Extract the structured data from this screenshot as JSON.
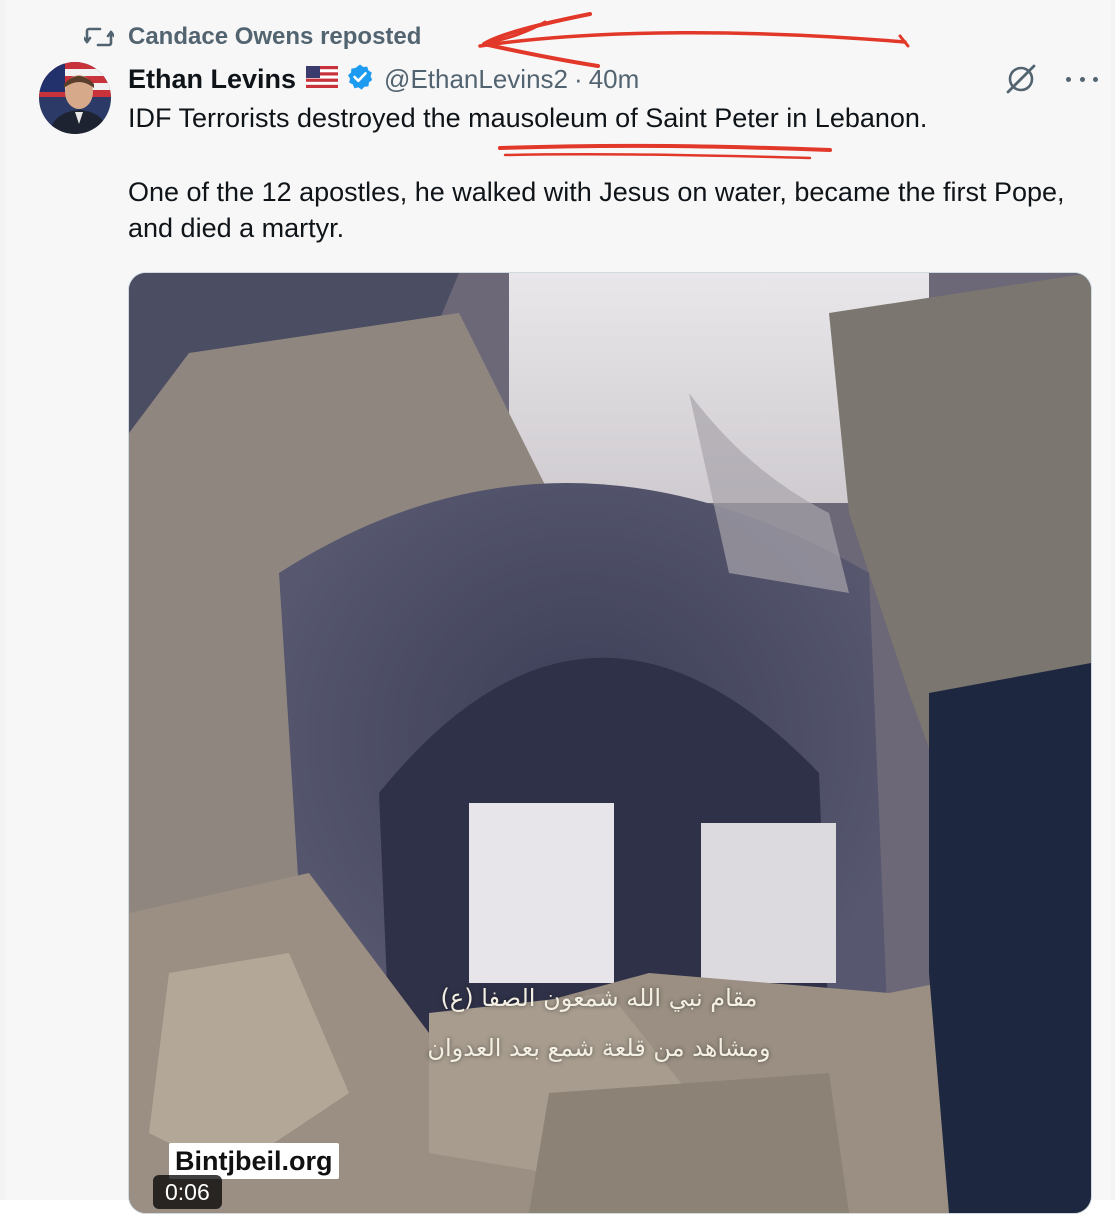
{
  "repost": {
    "icon": "repost-icon",
    "text": "Candace Owens reposted"
  },
  "author": {
    "name": "Ethan Levins",
    "flag": "us-flag",
    "verified_icon": "verified-badge-icon",
    "handle": "@EthanLevins2",
    "separator": "·",
    "time": "40m"
  },
  "tweet": {
    "line1": "IDF Terrorists destroyed the mausoleum of Saint Peter in Lebanon.",
    "line2": "One of the 12 apostles, he walked with Jesus on water, became the first Pope, and died a martyr."
  },
  "media": {
    "caption_ar_1": "مقام نبي الله شمعون الصفا (ع)",
    "caption_ar_2": "ومشاهد من قلعة شمع بعد العدوان",
    "watermark": "Bintjbeil.org",
    "duration": "0:06"
  },
  "icons": {
    "grok": "grok-icon",
    "more": "more-icon"
  },
  "colors": {
    "secondary_text": "#536471",
    "verified_blue": "#1d9bf0",
    "annotation_red": "#e2382a"
  }
}
